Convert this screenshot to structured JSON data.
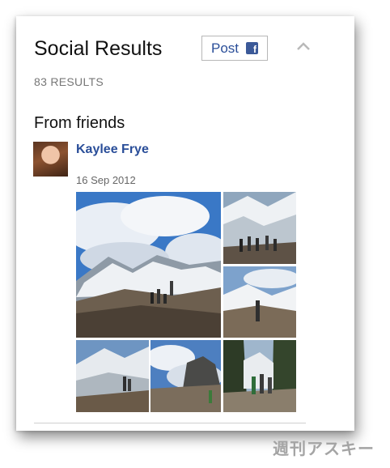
{
  "panel": {
    "title": "Social Results",
    "post_button": {
      "label": "Post",
      "icon": "facebook-icon",
      "icon_glyph": "f"
    },
    "collapse_icon": "chevron-up-icon",
    "results_count": "83 RESULTS",
    "section_heading": "From friends",
    "friend": {
      "name": "Kaylee Frye",
      "date": "16 Sep 2012",
      "photo_count": 6
    }
  },
  "colors": {
    "link": "#2a4e99",
    "facebook": "#3b5998",
    "muted_text": "#777777"
  },
  "watermark": "週刊アスキー"
}
